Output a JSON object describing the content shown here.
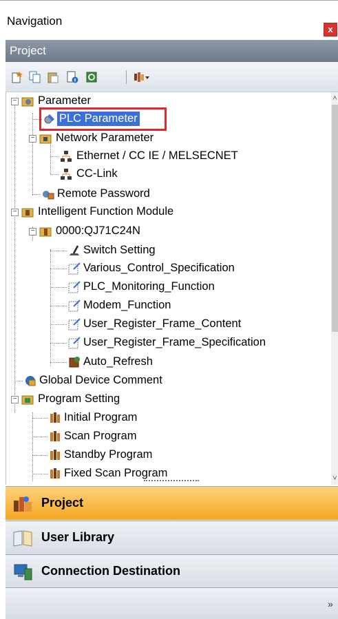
{
  "window": {
    "title": "Navigation",
    "close_glyph": "x"
  },
  "panel": {
    "header": "Project"
  },
  "toolbar": {
    "icons": [
      "new-data-icon",
      "copy-icon",
      "paste-icon",
      "property-icon",
      "refresh-icon",
      "filter-dropdown-icon"
    ]
  },
  "tree": {
    "items": [
      {
        "label": "Parameter",
        "icon": "parameter-folder-icon"
      },
      {
        "label": "PLC Parameter",
        "icon": "plc-parameter-icon",
        "highlighted": true
      },
      {
        "label": "Network Parameter",
        "icon": "network-folder-icon"
      },
      {
        "label": "Ethernet / CC IE / MELSECNET",
        "icon": "network-node-icon"
      },
      {
        "label": "CC-Link",
        "icon": "network-node-icon"
      },
      {
        "label": "Remote Password",
        "icon": "remote-password-icon"
      },
      {
        "label": "Intelligent Function Module",
        "icon": "module-folder-icon"
      },
      {
        "label": "0000:QJ71C24N",
        "icon": "module-icon"
      },
      {
        "label": "Switch Setting",
        "icon": "switch-setting-icon"
      },
      {
        "label": "Various_Control_Specification",
        "icon": "setting-icon"
      },
      {
        "label": "PLC_Monitoring_Function",
        "icon": "setting-icon"
      },
      {
        "label": "Modem_Function",
        "icon": "setting-icon"
      },
      {
        "label": "User_Register_Frame_Content",
        "icon": "setting-icon"
      },
      {
        "label": "User_Register_Frame_Specification",
        "icon": "setting-icon"
      },
      {
        "label": "Auto_Refresh",
        "icon": "auto-refresh-icon"
      },
      {
        "label": "Global Device Comment",
        "icon": "device-comment-icon"
      },
      {
        "label": "Program Setting",
        "icon": "program-folder-icon"
      },
      {
        "label": "Initial Program",
        "icon": "program-icon"
      },
      {
        "label": "Scan Program",
        "icon": "program-icon"
      },
      {
        "label": "Standby Program",
        "icon": "program-icon"
      },
      {
        "label": "Fixed Scan Program",
        "icon": "program-icon"
      }
    ]
  },
  "sections": {
    "project": "Project",
    "user_library": "User Library",
    "connection_destination": "Connection Destination"
  },
  "colors": {
    "active_section": "#f5a623",
    "header": "#7a8796",
    "highlight_box": "#e3262c",
    "selected_item": "#3b6fd9"
  }
}
